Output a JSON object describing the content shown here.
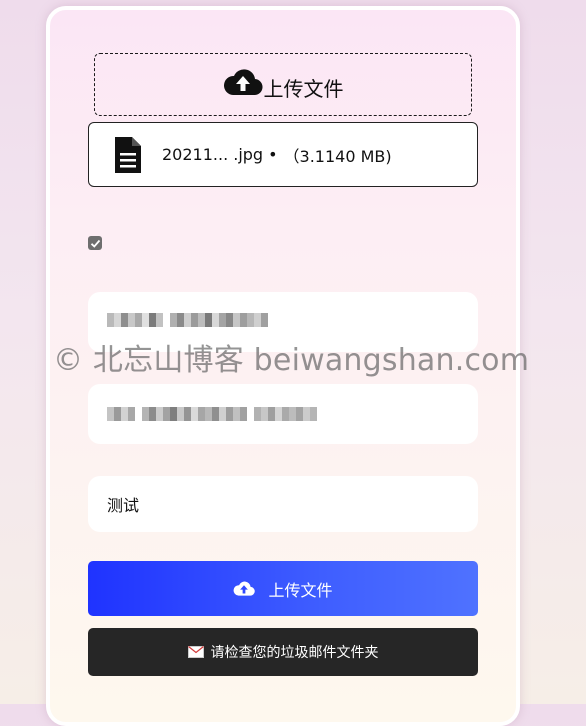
{
  "dropzone": {
    "label": "上传文件",
    "icon": "cloud-upload-icon"
  },
  "file": {
    "name": "20211... .jpg",
    "separator": "•",
    "size": "（3.1140 MB)",
    "icon": "document-icon"
  },
  "consent_checkbox": {
    "checked": true
  },
  "form": {
    "subject_value": "测试"
  },
  "watermark": "© 北忘山博客 beiwangshan.com",
  "upload_button": {
    "label": "上传文件",
    "icon": "cloud-upload-icon"
  },
  "notice": {
    "text": "请检查您的垃圾邮件文件夹",
    "icon": "envelope-icon"
  },
  "colors": {
    "upload_button_start": "#1f33ff",
    "upload_button_end": "#4f72ff",
    "notice_bg": "#262626"
  }
}
